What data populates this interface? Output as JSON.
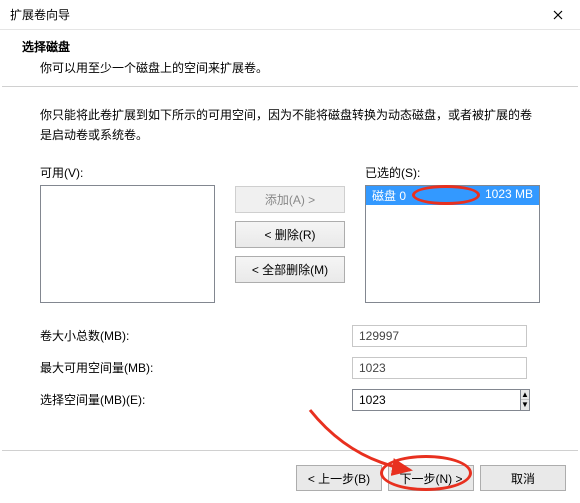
{
  "window": {
    "title": "扩展卷向导"
  },
  "header": {
    "heading": "选择磁盘",
    "description": "你可以用至少一个磁盘上的空间来扩展卷。"
  },
  "info": "你只能将此卷扩展到如下所示的可用空间，因为不能将磁盘转换为动态磁盘，或者被扩展的卷是启动卷或系统卷。",
  "available": {
    "label": "可用(V):"
  },
  "selected": {
    "label": "已选的(S):",
    "items": [
      {
        "disk": "磁盘 0",
        "size": "1023 MB"
      }
    ]
  },
  "buttons": {
    "add": "添加(A) >",
    "remove": "< 删除(R)",
    "remove_all": "< 全部删除(M)"
  },
  "fields": {
    "total_label": "卷大小总数(MB):",
    "total_value": "129997",
    "max_label": "最大可用空间量(MB):",
    "max_value": "1023",
    "choose_label": "选择空间量(MB)(E):",
    "choose_value": "1023"
  },
  "footer": {
    "back": "< 上一步(B)",
    "next": "下一步(N) >",
    "cancel": "取消"
  }
}
